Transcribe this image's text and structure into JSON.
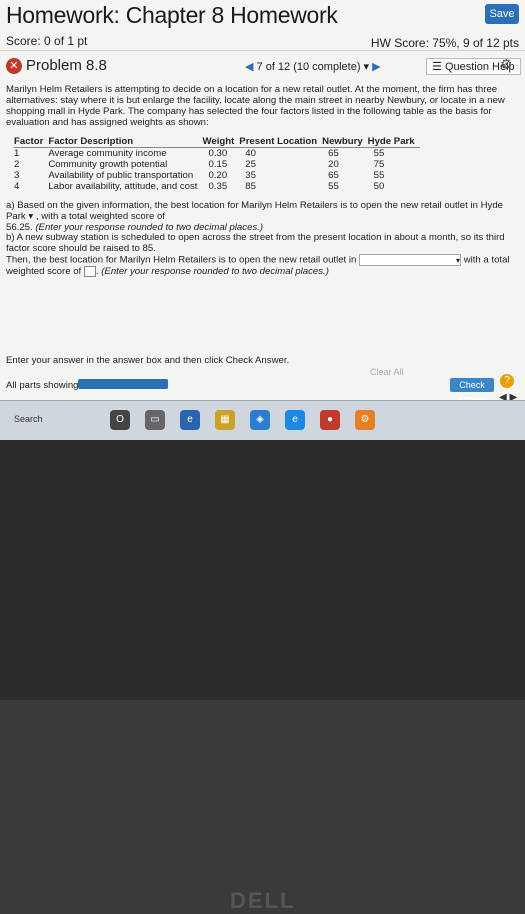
{
  "header": {
    "title": "Homework: Chapter 8 Homework",
    "save_label": "Save",
    "score": "Score: 0 of 1 pt",
    "hw_score": "HW Score: 75%, 9 of 12 pts"
  },
  "problem": {
    "title": "Problem 8.8",
    "nav_label": "7 of 12 (10 complete)",
    "question_help": "Question Help"
  },
  "content": {
    "intro": "Marilyn Helm Retailers is attempting to decide on a location for a new retail outlet. At the moment, the firm has three alternatives: stay where it is but enlarge the facility, locate along the main street in nearby Newbury, or locate in a new shopping mall in Hyde Park. The company has selected the four factors listed in the following table as the basis for evaluation and has assigned weights as shown:",
    "table": {
      "headers": [
        "Factor",
        "Factor Description",
        "Weight",
        "Present Location",
        "Newbury",
        "Hyde Park"
      ],
      "rows": [
        [
          "1",
          "Average community income",
          "0.30",
          "40",
          "65",
          "55"
        ],
        [
          "2",
          "Community growth potential",
          "0.15",
          "25",
          "20",
          "75"
        ],
        [
          "3",
          "Availability of public transportation",
          "0.20",
          "35",
          "65",
          "55"
        ],
        [
          "4",
          "Labor availability, attitude, and cost",
          "0.35",
          "85",
          "55",
          "50"
        ]
      ]
    },
    "part_a_prefix": "a) Based on the given information, the best location for Marilyn Helm Retailers is to open the new retail outlet in Hyde Park",
    "part_a_suffix": ", with a total weighted score of",
    "part_a_value": "56.25",
    "part_a_note": "(Enter your response rounded to two decimal places.)",
    "part_b_1": "b) A new subway station is scheduled to open across the street from the present location in about a month, so its third factor score should be raised to 85.",
    "part_b_2": "Then, the best location for Marilyn Helm Retailers is to open the new retail outlet in",
    "part_b_3": "with a total weighted score of",
    "part_b_4": "(Enter your response rounded to two decimal places.)",
    "instruction": "Enter your answer in the answer box and then click Check Answer.",
    "all_parts": "All parts showing",
    "clear_all": "Clear All",
    "check_answer": "Check Answer"
  },
  "taskbar": {
    "search": "Search"
  },
  "bezel": {
    "brand": "DELL"
  }
}
